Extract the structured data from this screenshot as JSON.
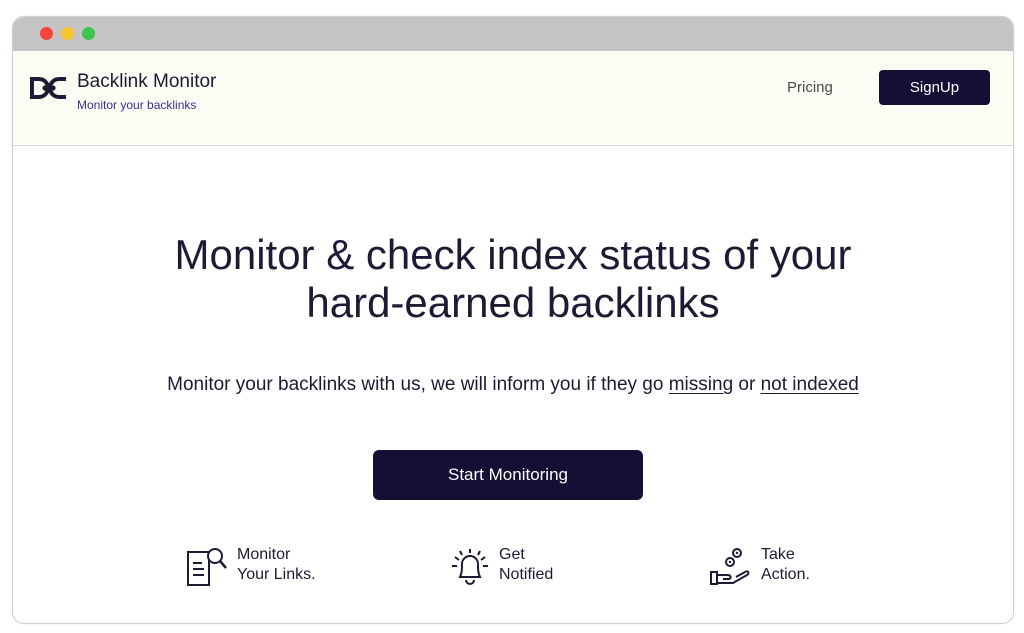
{
  "window": {
    "controls": [
      "close",
      "minimize",
      "maximize"
    ],
    "colors": {
      "close": "#f5453d",
      "minimize": "#f8c42b",
      "maximize": "#3fc44e"
    }
  },
  "header": {
    "logo_icon": "chain-link-logo-icon",
    "brand_name": "Backlink Monitor",
    "tagline": "Monitor your backlinks",
    "nav": {
      "pricing_label": "Pricing",
      "signup_label": "SignUp"
    }
  },
  "hero": {
    "title_line1": "Monitor & check index status of your",
    "title_line2": "hard-earned backlinks",
    "subtitle_prefix": "Monitor your backlinks with us, we will inform you if they go ",
    "subtitle_link1": "missing",
    "subtitle_middle": " or ",
    "subtitle_link2": "not indexed",
    "cta_label": "Start Monitoring"
  },
  "features": [
    {
      "icon": "document-search-icon",
      "line1": "Monitor",
      "line2": "Your Links."
    },
    {
      "icon": "bell-icon",
      "line1": "Get",
      "line2": "Notified"
    },
    {
      "icon": "hand-gears-icon",
      "line1": "Take",
      "line2": "Action."
    }
  ],
  "colors": {
    "primary": "#140f35",
    "text": "#1d1b33",
    "tagline": "#3d2f8c",
    "navbar_bg": "#fcfcf4",
    "titlebar_bg": "#c6c3c6"
  }
}
